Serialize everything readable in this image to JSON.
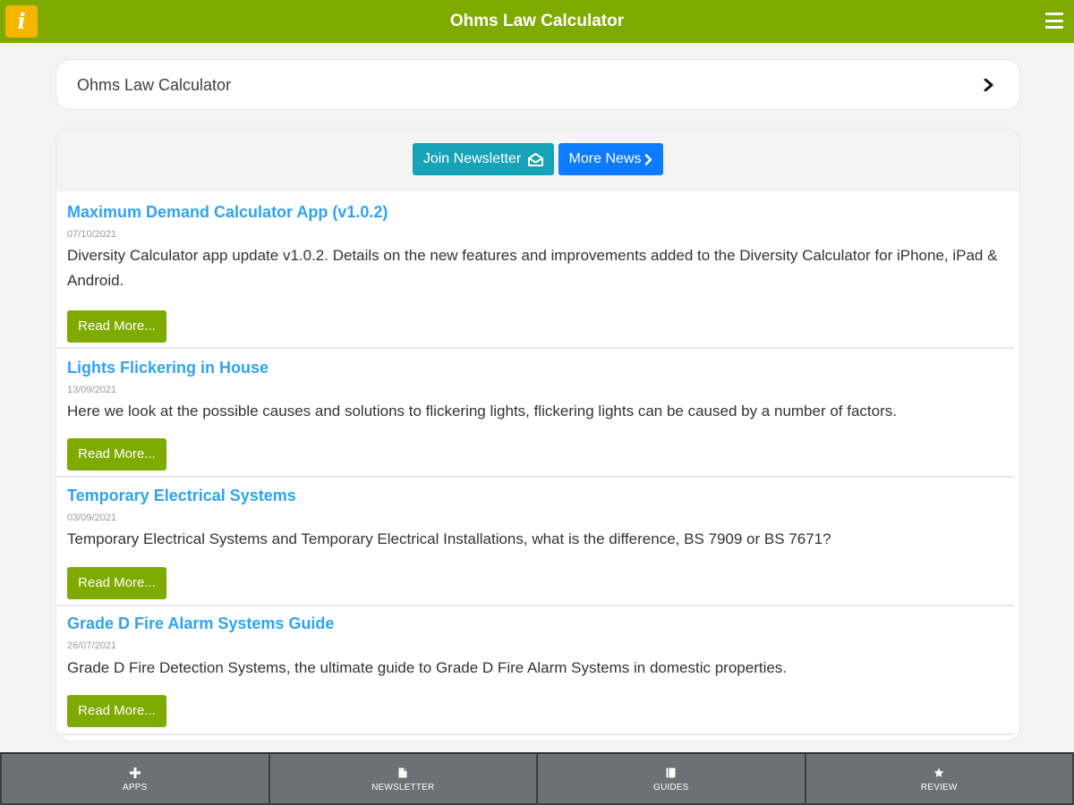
{
  "header": {
    "title": "Ohms Law Calculator",
    "logo_letter": "i",
    "logo_color": "#f6b500",
    "bar_color": "#7faa00"
  },
  "breadcrumb": {
    "label": "Ohms Law Calculator",
    "icon": "chevron-right-icon"
  },
  "news": {
    "join_label": "Join Newsletter",
    "join_icon": "envelope-open-icon",
    "more_label": "More News",
    "more_icon": "chevron-right-icon",
    "articles": [
      {
        "title": "Maximum Demand Calculator App (v1.0.2)",
        "date": "07/10/2021",
        "description": "Diversity Calculator app update v1.0.2. Details on the new features and improvements added to the Diversity Calculator for iPhone, iPad & Android.",
        "button": "Read More..."
      },
      {
        "title": "Lights Flickering in House",
        "date": "13/09/2021",
        "description": "Here we look at the possible causes and solutions to flickering lights, flickering lights can be caused by a number of factors.",
        "button": "Read More..."
      },
      {
        "title": "Temporary Electrical Systems",
        "date": "03/09/2021",
        "description": "Temporary Electrical Systems and Temporary Electrical Installations, what is the difference, BS 7909 or BS 7671?",
        "button": "Read More..."
      },
      {
        "title": "Grade D Fire Alarm Systems Guide",
        "date": "26/07/2021",
        "description": "Grade D Fire Detection Systems, the ultimate guide to Grade D Fire Alarm Systems in domestic properties.",
        "button": "Read More..."
      }
    ]
  },
  "bottom_tabs": [
    {
      "label": "APPS",
      "icon": "plus-icon"
    },
    {
      "label": "NEWSLETTER",
      "icon": "file-icon"
    },
    {
      "label": "GUIDES",
      "icon": "book-icon"
    },
    {
      "label": "REVIEW",
      "icon": "star-icon"
    }
  ],
  "colors": {
    "accent_green": "#7faa00",
    "link_blue": "#2ea3f2",
    "info_teal": "#17a2b8",
    "primary_blue": "#0d7bff",
    "tabbar_gray": "#6a7278"
  }
}
